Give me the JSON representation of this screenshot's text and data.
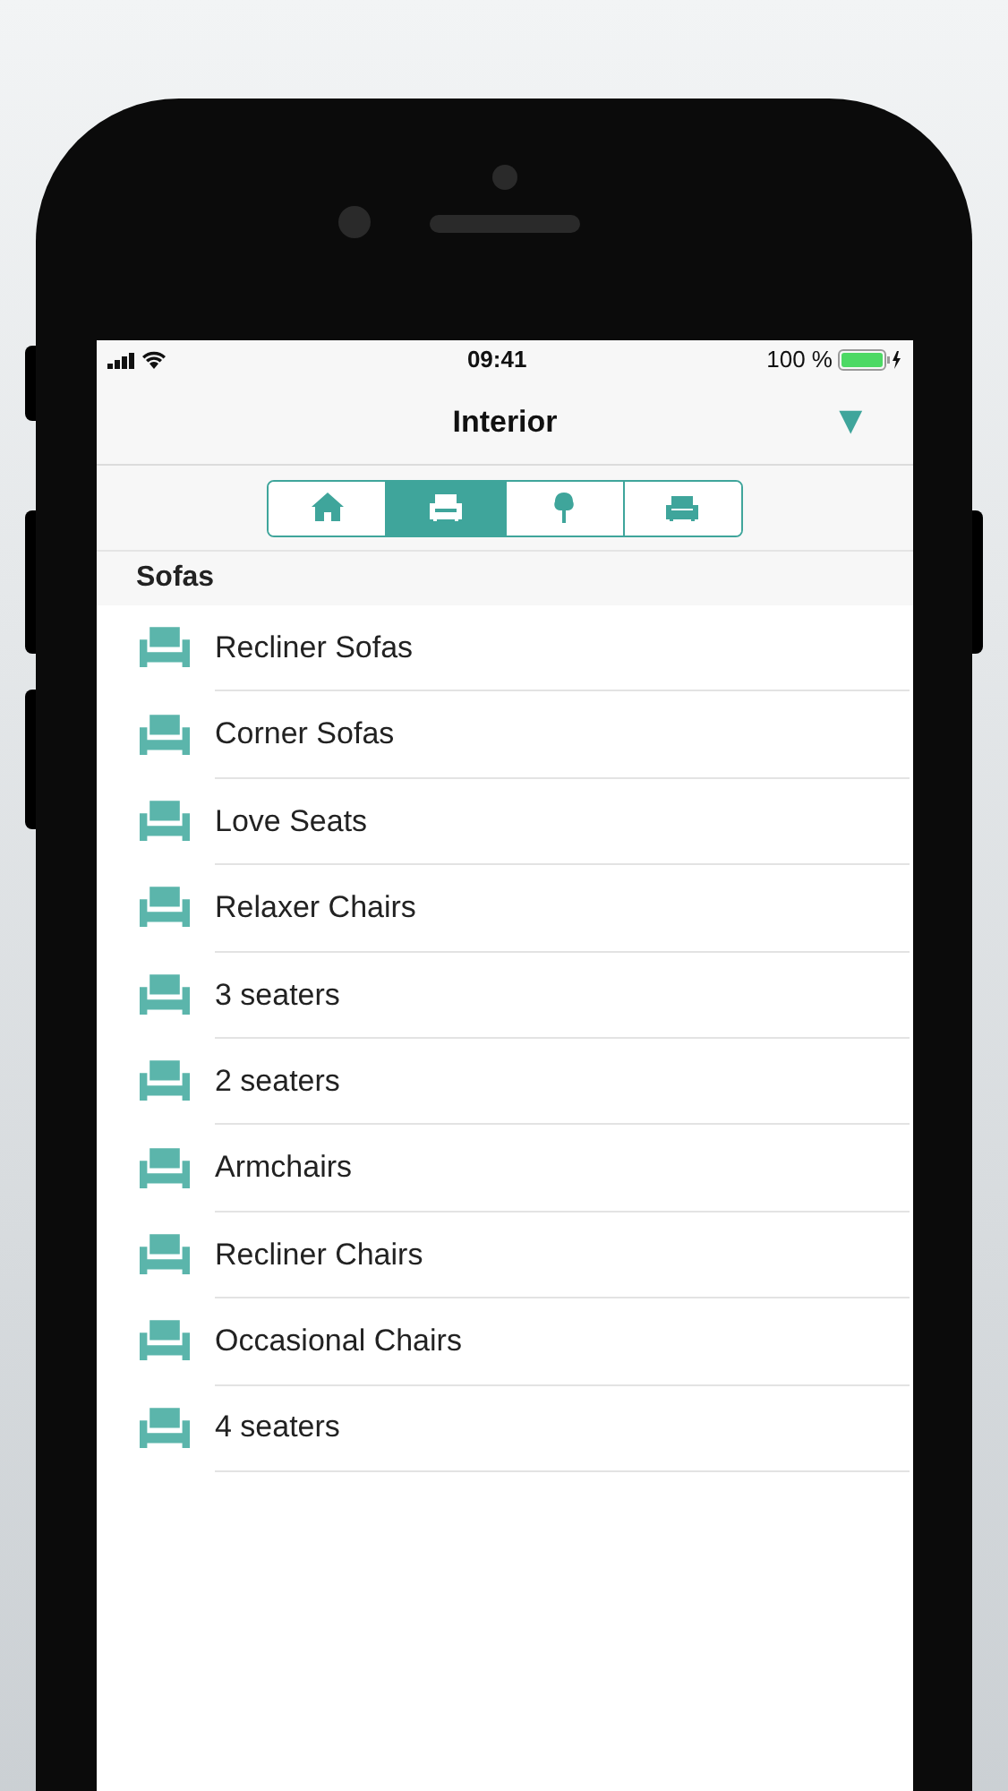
{
  "status_bar": {
    "time": "09:41",
    "battery": "100 %"
  },
  "nav": {
    "title": "Interior",
    "menu_glyph": "▼"
  },
  "tabs": [
    {
      "kind": "home",
      "selected": false
    },
    {
      "kind": "armchair",
      "selected": true
    },
    {
      "kind": "tree",
      "selected": false
    },
    {
      "kind": "sofa",
      "selected": false
    }
  ],
  "section": {
    "title": "Sofas"
  },
  "items": [
    {
      "label": "Recliner Sofas"
    },
    {
      "label": "Corner Sofas"
    },
    {
      "label": "Love Seats"
    },
    {
      "label": "Relaxer Chairs"
    },
    {
      "label": "3 seaters"
    },
    {
      "label": "2 seaters"
    },
    {
      "label": "Armchairs"
    },
    {
      "label": "Recliner Chairs"
    },
    {
      "label": "Occasional Chairs"
    },
    {
      "label": "4 seaters"
    }
  ]
}
